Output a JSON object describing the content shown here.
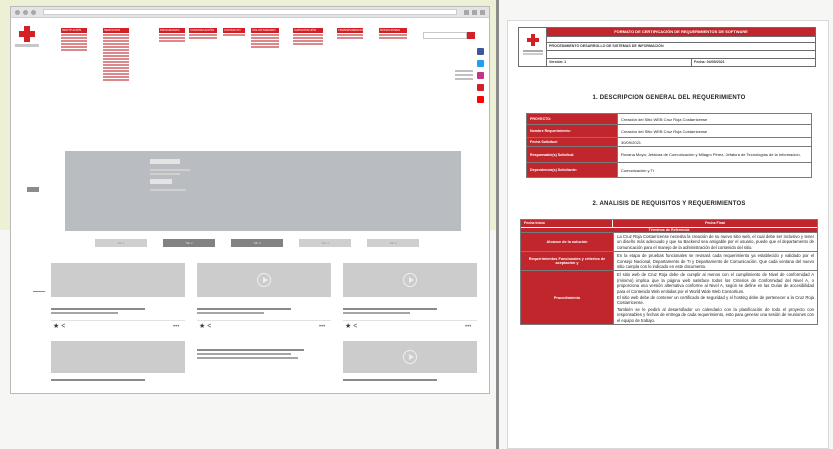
{
  "document": {
    "header": {
      "title": "FORMATO DE CERTIFICACIÓN DE REQUERIMIENTOS DE SOFTWARE",
      "process": "PROCEDIMIENTO DESARROLLO DE SISTEMAS DE INFORMACIÓN",
      "version_label": "Versión: 1",
      "date_label": "Fecha: 04/05/2021"
    },
    "section1_title": "1. DESCRIPCION GENERAL DEL REQUERIMIENTO",
    "general": [
      {
        "key": "PROYECTO:",
        "value": "Creación del Sitio WEB Cruz Roja Costarricense"
      },
      {
        "key": "Nombre Requerimiento:",
        "value": "Creación del Sitio WEB Cruz Roja Costarricense"
      },
      {
        "key": "Fecha Solicitud:",
        "value": "30/09/2021"
      },
      {
        "key": "Responsable(s) Solicitud:",
        "value": "Roxana Moya, Jefatura de Comunicación y Milagro Pérez, Jefatura de Tecnologías de la Información."
      },
      {
        "key": "Dependencia(s) Solicitante:",
        "value": "Comunicación y TI"
      }
    ],
    "section2_title": "2. ANALISIS DE REQUISITOS Y REQUERIMIENTOS",
    "requirements_header": {
      "start": "Fecha Inicio",
      "end": "Fecha Final",
      "sub": "Términos de Referencia"
    },
    "requirements": [
      {
        "key": "Alcance de la solución",
        "paragraphs": [
          "La Cruz Roja Costarricense necesita la creación de su nuevo sitio web, el cual debe ser inclusivo y tener un diseño más adecuado y que su Backend sea amigable por el usuario, puede que el departamento de comunicación para el manejo de la administración del contenido del sitio."
        ]
      },
      {
        "key": "Requerimientos Funcionales y criterios de aceptación y",
        "paragraphs": [
          "En la etapa de pruebas funcionales se revisará cada requerimiento ya establecido y validado por el Consejo Nacional, Departamento de TI y Departamento de Comunicación. Que cada ventana del nuevo sitio cumpla con lo indicado en este documento."
        ]
      },
      {
        "key": "Procedimiento",
        "paragraphs": [
          "El sitio web de Cruz Roja debe de cumplir al menos con el cumplimiento de Nivel de conformidad A (mínimo) implica que la página web satisface todos los Criterios de Conformidad del Nivel A, o proporciona una versión alternativa conforme al Nivel A, según se define en las Guías de accesibilidad para el Contenido Web emitidas por el World Wide Web Consortium.",
          "El sitio web debe de contener un certificado de seguridad y el hosting debe de pertenecer a la Cruz Roja Costarricense.",
          "También se le pedirá al desarrollador un calendario con la planificación de todo el proyecto con responsables y fechas de entrega de cada requerimiento, esto para generar una sesión de reuniones con el equipo de trabajo."
        ]
      }
    ]
  },
  "browser": {
    "menu_tabs": [
      "INSTITUCIÓN",
      "SERVICIOS",
      "PROGRAMAS",
      "COMUNICACIÓN",
      "CONTACTO",
      "VOLUNTARIADO",
      "CAPACITACIÓN",
      "TRANSPARENCIA",
      "DONACIONES"
    ],
    "section_tabs": [
      "Tab 1",
      "Tab 2",
      "Tab 3",
      "Tab 4",
      "Tab 5"
    ]
  },
  "colors": {
    "brand_red": "#d32026",
    "doc_red": "#c0262c",
    "social": [
      "#3b5998",
      "#1da1f2",
      "#c13584",
      "#d32026",
      "#ff0000"
    ]
  },
  "icons": [
    "cross-logo-icon",
    "search-icon",
    "facebook-icon",
    "twitter-icon",
    "instagram-icon",
    "youtube-icon",
    "play-icon",
    "star-icon",
    "share-icon",
    "more-icon"
  ]
}
